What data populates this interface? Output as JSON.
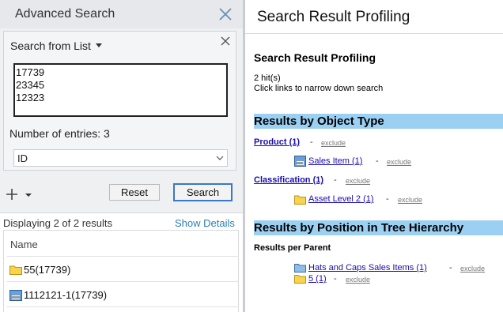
{
  "left": {
    "title": "Advanced Search",
    "list": {
      "title": "Search from List",
      "entries": "17739\n23345\n12323",
      "count_label": "Number of entries: 3",
      "id_select_value": "ID"
    },
    "buttons": {
      "reset": "Reset",
      "search": "Search"
    },
    "results": {
      "summary": "Displaying 2 of 2 results",
      "show_details": "Show Details",
      "column_name": "Name",
      "rows": [
        {
          "label": "55(17739)",
          "icon": "folder-icon"
        },
        {
          "label": "1112121-1(17739)",
          "icon": "product-icon"
        }
      ]
    }
  },
  "right": {
    "title": "Search Result Profiling",
    "heading": "Search Result Profiling",
    "hits": "2 hit(s)",
    "hint": "Click links to narrow down search",
    "by_object_type": {
      "title": "Results by Object Type",
      "product": "Product (1)",
      "sales_item": "Sales Item (1)",
      "classification": "Classification (1)",
      "asset_level": "Asset Level 2 (1)"
    },
    "by_position": {
      "title": "Results by Position in Tree Hierarchy",
      "per_parent": "Results per Parent",
      "hats_caps": "Hats and Caps Sales Items (1)",
      "five": "5 (1)"
    },
    "dash": "-",
    "exclude": "exclude"
  },
  "colors": {
    "section_bar": "#9bd0f3",
    "link": "#1a0dab",
    "accent_blue": "#3b78c7",
    "show_details": "#2a7fb5",
    "folder": "#f7d44c"
  }
}
